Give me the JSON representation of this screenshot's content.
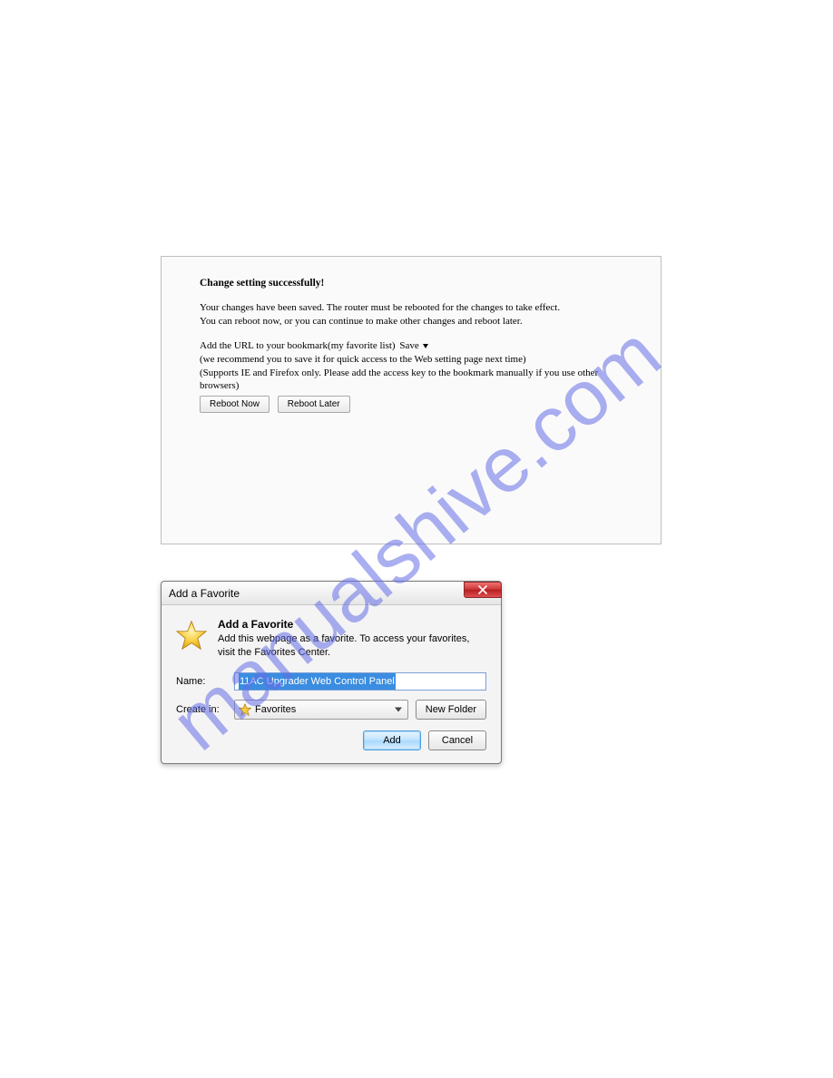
{
  "watermark": "manualshive.com",
  "router": {
    "heading": "Change setting successfully!",
    "line1": "Your changes have been saved. The router must be rebooted for the changes to take effect.",
    "line2": "You can reboot now, or you can continue to make other changes and reboot later.",
    "bm_prefix": "Add the URL to your bookmark(my favorite list)",
    "save_label": "Save",
    "recommend": "(we recommend you to save it for quick access to the Web setting page next time)",
    "supports": "(Supports IE and Firefox only. Please add the access key to the bookmark manually if you use other browsers)",
    "reboot_now": "Reboot Now",
    "reboot_later": "Reboot Later"
  },
  "dialog": {
    "title": "Add a Favorite",
    "hero_title": "Add a Favorite",
    "hero_desc": "Add this webpage as a favorite. To access your favorites, visit the Favorites Center.",
    "name_label": "Name:",
    "name_value": "11AC Upgrader Web Control Panel",
    "create_label": "Create in:",
    "folder_value": "Favorites",
    "new_folder": "New Folder",
    "add": "Add",
    "cancel": "Cancel"
  }
}
